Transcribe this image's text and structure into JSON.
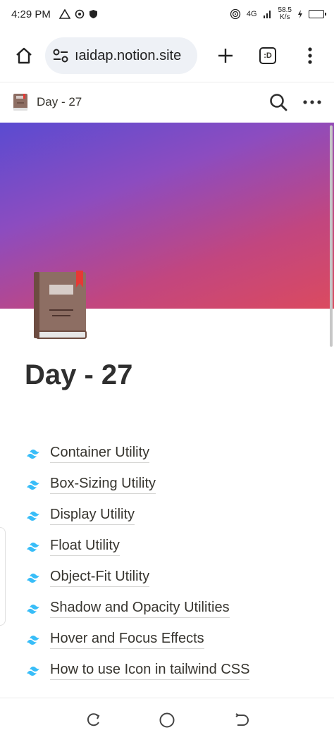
{
  "status_bar": {
    "time": "4:29 PM",
    "network": "4G",
    "speed_value": "58.5",
    "speed_unit": "K/s"
  },
  "browser": {
    "url": "ıaidap.notion.site",
    "tab_count": ":D"
  },
  "page": {
    "topbar_title": "Day - 27",
    "title": "Day - 27",
    "items": [
      {
        "label": "Container Utility"
      },
      {
        "label": "Box-Sizing Utility"
      },
      {
        "label": "Display Utility"
      },
      {
        "label": "Float Utility"
      },
      {
        "label": "Object-Fit Utility"
      },
      {
        "label": "Shadow and Opacity Utilities"
      },
      {
        "label": "Hover and Focus Effects"
      },
      {
        "label": "How to use Icon in tailwind CSS"
      }
    ]
  },
  "icons": {
    "page": "book-icon",
    "item": "tailwind-icon"
  },
  "colors": {
    "cover_start": "#5a4bd1",
    "cover_end": "#db4a5f",
    "tailwind": "#38bdf8"
  }
}
